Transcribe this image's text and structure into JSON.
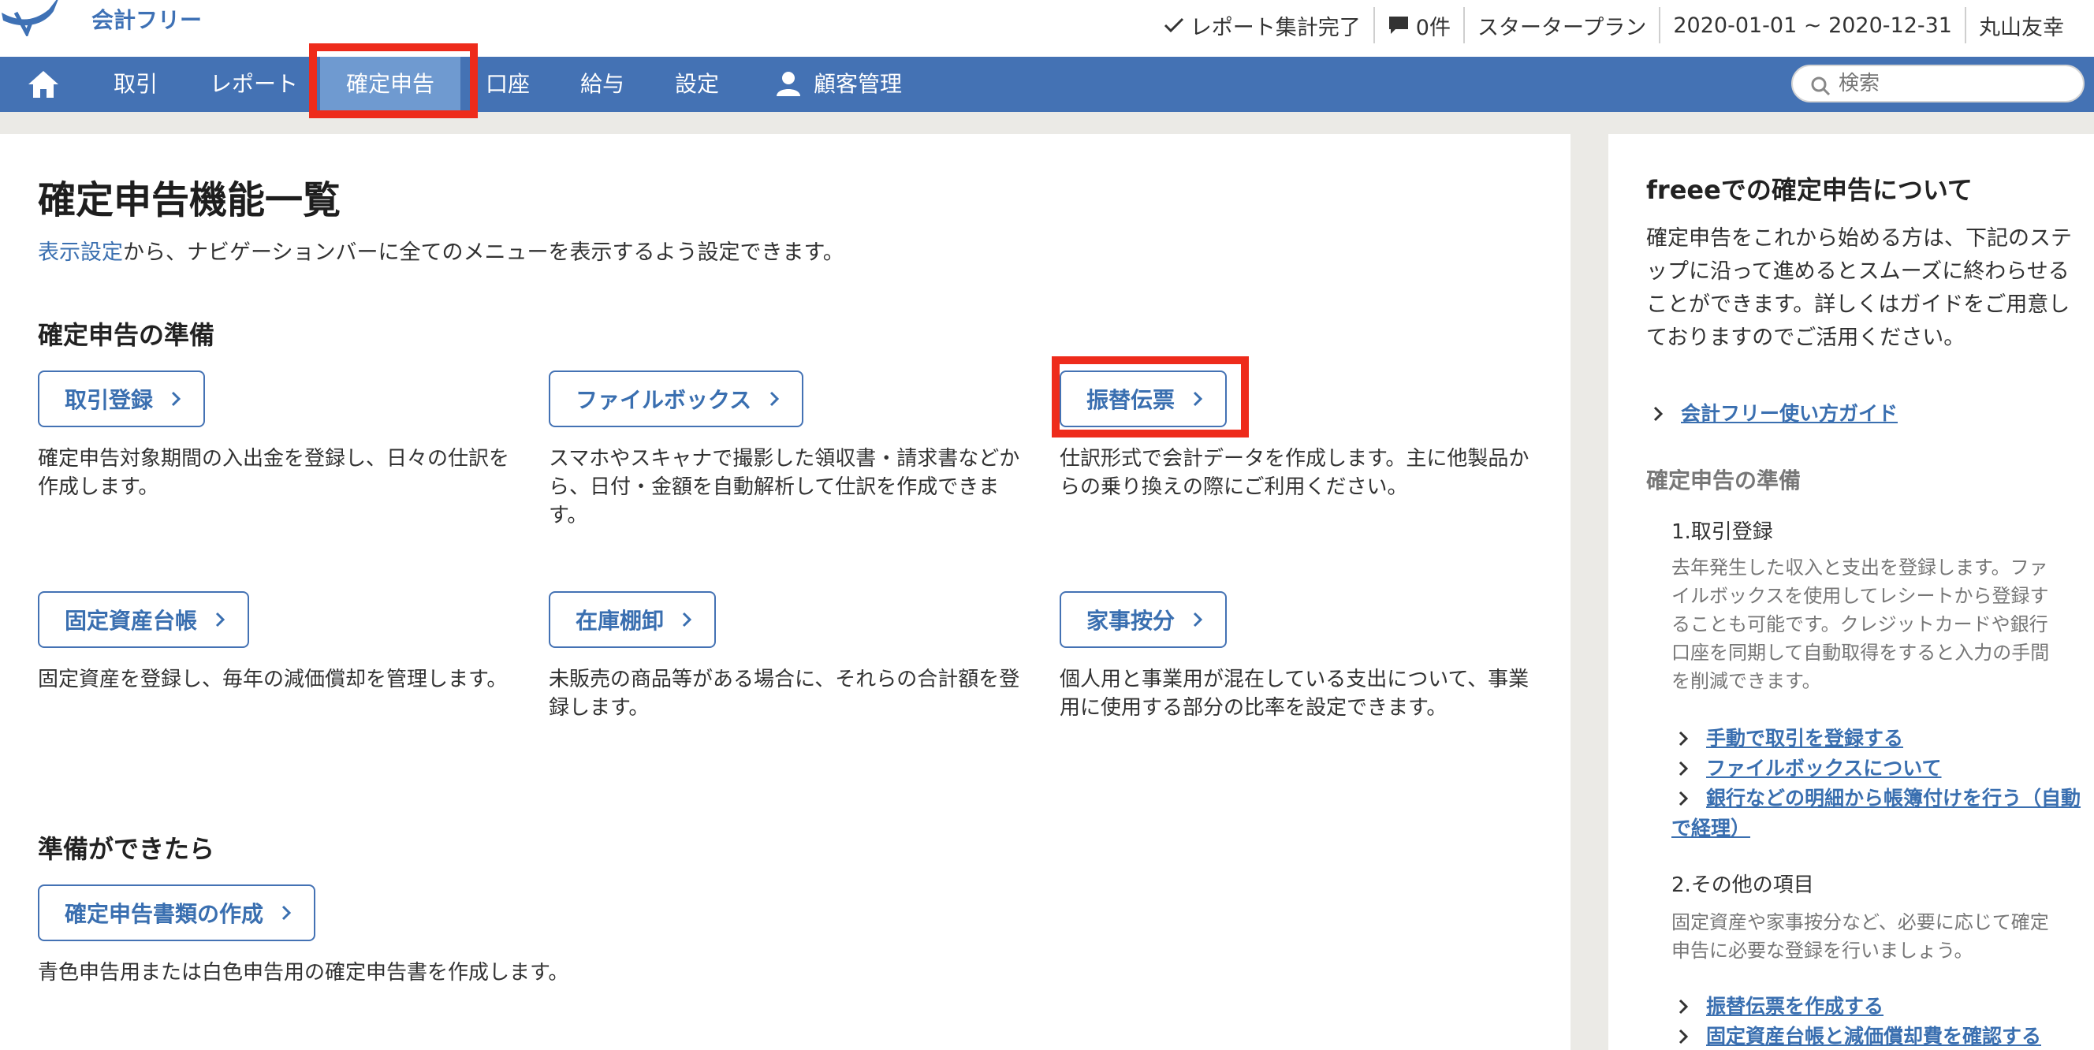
{
  "header": {
    "brand": "会計フリー",
    "report_status": "レポート集計完了",
    "notifications": "0件",
    "plan": "スタータープラン",
    "period": "2020-01-01 ~ 2020-12-31",
    "user": "丸山友幸"
  },
  "nav": {
    "items": [
      "取引",
      "レポート",
      "確定申告",
      "口座",
      "給与",
      "設定",
      "顧客管理"
    ],
    "active": "確定申告",
    "search_placeholder": "検索"
  },
  "main": {
    "title": "確定申告機能一覧",
    "intro_link": "表示設定",
    "intro_text": "から、ナビゲーションバーに全てのメニューを表示するよう設定できます。",
    "prep_heading": "確定申告の準備",
    "features": [
      {
        "label": "取引登録",
        "desc": "確定申告対象期間の入出金を登録し、日々の仕訳を作成します。"
      },
      {
        "label": "ファイルボックス",
        "desc": "スマホやスキャナで撮影した領収書・請求書などから、日付・金額を自動解析して仕訳を作成できます。"
      },
      {
        "label": "振替伝票",
        "desc": "仕訳形式で会計データを作成します。主に他製品からの乗り換えの際にご利用ください。"
      },
      {
        "label": "固定資産台帳",
        "desc": "固定資産を登録し、毎年の減価償却を管理します。"
      },
      {
        "label": "在庫棚卸",
        "desc": "未販売の商品等がある場合に、それらの合計額を登録します。"
      },
      {
        "label": "家事按分",
        "desc": "個人用と事業用が混在している支出について、事業用に使用する部分の比率を設定できます。"
      }
    ],
    "ready_heading": "準備ができたら",
    "ready_button": "確定申告書類の作成",
    "ready_desc": "青色申告用または白色申告用の確定申告書を作成します。"
  },
  "sidebar": {
    "title": "freeeでの確定申告について",
    "text": "確定申告をこれから始める方は、下記のステップに沿って進めるとスムーズに終わらせることができます。詳しくはガイドをご用意しておりますのでご活用ください。",
    "guide_link": "会計フリー使い方ガイド",
    "prep_heading": "確定申告の準備",
    "step1_title": "1.取引登録",
    "step1_text": "去年発生した収入と支出を登録します。ファイルボックスを使用してレシートから登録することも可能です。クレジットカードや銀行口座を同期して自動取得をすると入力の手間を削減できます。",
    "step1_links": [
      "手動で取引を登録する",
      "ファイルボックスについて",
      "銀行などの明細から帳簿付けを行う（自動で経理）"
    ],
    "step2_title": "2.その他の項目",
    "step2_text": "固定資産や家事按分など、必要に応じて確定申告に必要な登録を行いましょう。",
    "step2_links": [
      "振替伝票を作成する",
      "固定資産台帳と減価償却費を確認する"
    ]
  },
  "colors": {
    "nav_bg": "#4472b4",
    "nav_active": "#6f9ad0",
    "link": "#3a6fb0",
    "highlight": "#ee2b1b"
  }
}
